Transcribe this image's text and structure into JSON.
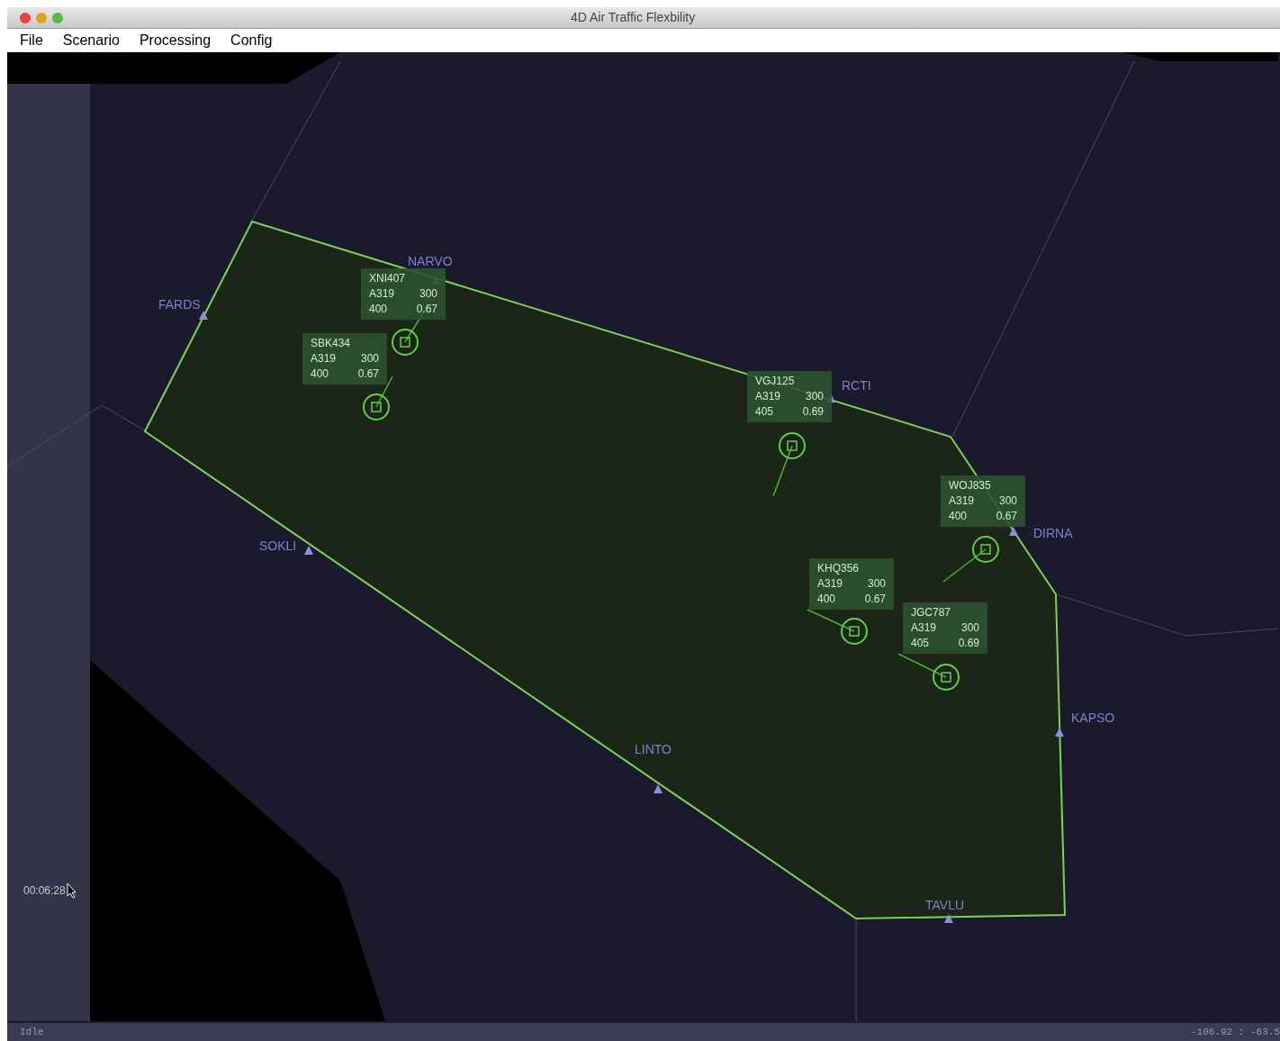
{
  "window": {
    "title": "4D Air Traffic Flexbility"
  },
  "menu": [
    {
      "label": "File"
    },
    {
      "label": "Scenario"
    },
    {
      "label": "Processing"
    },
    {
      "label": "Config"
    }
  ],
  "map": {
    "waypoints": [
      {
        "name": "FARDS"
      },
      {
        "name": "NARVO"
      },
      {
        "name": "RCTI"
      },
      {
        "name": "DIRNA"
      },
      {
        "name": "SOKLI"
      },
      {
        "name": "LINTO"
      },
      {
        "name": "KAPSO"
      },
      {
        "name": "TAVLU"
      }
    ],
    "flights": [
      {
        "lines": [
          [
            "XNI407"
          ],
          [
            "A319",
            "300"
          ],
          [
            "400",
            "0.67"
          ]
        ]
      },
      {
        "lines": [
          [
            "SBK434"
          ],
          [
            "A319",
            "300"
          ],
          [
            "400",
            "0.67"
          ]
        ]
      },
      {
        "lines": [
          [
            "VGJ125"
          ],
          [
            "A319",
            "300"
          ],
          [
            "405",
            "0.69"
          ]
        ]
      },
      {
        "lines": [
          [
            "WOJ835"
          ],
          [
            "A319",
            "300"
          ],
          [
            "400",
            "0.67"
          ]
        ]
      },
      {
        "lines": [
          [
            "KHQ356"
          ],
          [
            "A319",
            "300"
          ],
          [
            "400",
            "0.67"
          ]
        ]
      },
      {
        "lines": [
          [
            "JGC787"
          ],
          [
            "A319",
            "300"
          ],
          [
            "405",
            "0.69"
          ]
        ]
      }
    ],
    "clock": "00:06:28"
  },
  "status_bar": {
    "state": "Idle",
    "coordinates": "-106.92 : -63.5"
  }
}
